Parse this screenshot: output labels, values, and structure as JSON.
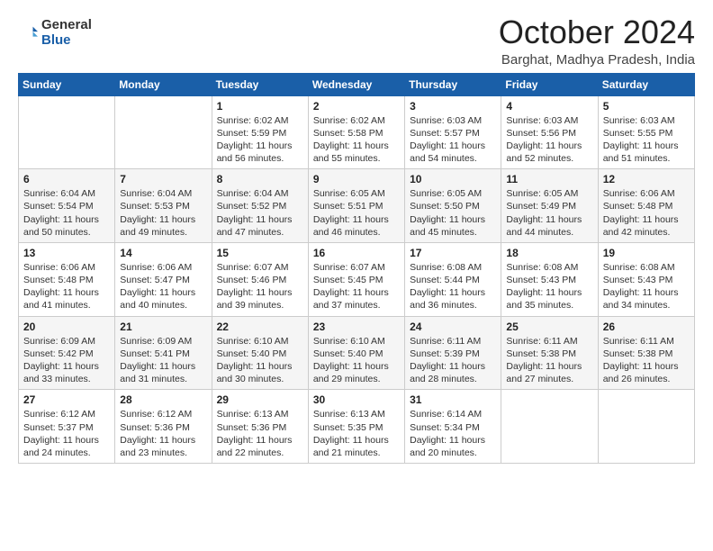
{
  "logo": {
    "general": "General",
    "blue": "Blue"
  },
  "header": {
    "month": "October 2024",
    "location": "Barghat, Madhya Pradesh, India"
  },
  "weekdays": [
    "Sunday",
    "Monday",
    "Tuesday",
    "Wednesday",
    "Thursday",
    "Friday",
    "Saturday"
  ],
  "weeks": [
    [
      {
        "day": "",
        "sunrise": "",
        "sunset": "",
        "daylight": ""
      },
      {
        "day": "",
        "sunrise": "",
        "sunset": "",
        "daylight": ""
      },
      {
        "day": "1",
        "sunrise": "Sunrise: 6:02 AM",
        "sunset": "Sunset: 5:59 PM",
        "daylight": "Daylight: 11 hours and 56 minutes."
      },
      {
        "day": "2",
        "sunrise": "Sunrise: 6:02 AM",
        "sunset": "Sunset: 5:58 PM",
        "daylight": "Daylight: 11 hours and 55 minutes."
      },
      {
        "day": "3",
        "sunrise": "Sunrise: 6:03 AM",
        "sunset": "Sunset: 5:57 PM",
        "daylight": "Daylight: 11 hours and 54 minutes."
      },
      {
        "day": "4",
        "sunrise": "Sunrise: 6:03 AM",
        "sunset": "Sunset: 5:56 PM",
        "daylight": "Daylight: 11 hours and 52 minutes."
      },
      {
        "day": "5",
        "sunrise": "Sunrise: 6:03 AM",
        "sunset": "Sunset: 5:55 PM",
        "daylight": "Daylight: 11 hours and 51 minutes."
      }
    ],
    [
      {
        "day": "6",
        "sunrise": "Sunrise: 6:04 AM",
        "sunset": "Sunset: 5:54 PM",
        "daylight": "Daylight: 11 hours and 50 minutes."
      },
      {
        "day": "7",
        "sunrise": "Sunrise: 6:04 AM",
        "sunset": "Sunset: 5:53 PM",
        "daylight": "Daylight: 11 hours and 49 minutes."
      },
      {
        "day": "8",
        "sunrise": "Sunrise: 6:04 AM",
        "sunset": "Sunset: 5:52 PM",
        "daylight": "Daylight: 11 hours and 47 minutes."
      },
      {
        "day": "9",
        "sunrise": "Sunrise: 6:05 AM",
        "sunset": "Sunset: 5:51 PM",
        "daylight": "Daylight: 11 hours and 46 minutes."
      },
      {
        "day": "10",
        "sunrise": "Sunrise: 6:05 AM",
        "sunset": "Sunset: 5:50 PM",
        "daylight": "Daylight: 11 hours and 45 minutes."
      },
      {
        "day": "11",
        "sunrise": "Sunrise: 6:05 AM",
        "sunset": "Sunset: 5:49 PM",
        "daylight": "Daylight: 11 hours and 44 minutes."
      },
      {
        "day": "12",
        "sunrise": "Sunrise: 6:06 AM",
        "sunset": "Sunset: 5:48 PM",
        "daylight": "Daylight: 11 hours and 42 minutes."
      }
    ],
    [
      {
        "day": "13",
        "sunrise": "Sunrise: 6:06 AM",
        "sunset": "Sunset: 5:48 PM",
        "daylight": "Daylight: 11 hours and 41 minutes."
      },
      {
        "day": "14",
        "sunrise": "Sunrise: 6:06 AM",
        "sunset": "Sunset: 5:47 PM",
        "daylight": "Daylight: 11 hours and 40 minutes."
      },
      {
        "day": "15",
        "sunrise": "Sunrise: 6:07 AM",
        "sunset": "Sunset: 5:46 PM",
        "daylight": "Daylight: 11 hours and 39 minutes."
      },
      {
        "day": "16",
        "sunrise": "Sunrise: 6:07 AM",
        "sunset": "Sunset: 5:45 PM",
        "daylight": "Daylight: 11 hours and 37 minutes."
      },
      {
        "day": "17",
        "sunrise": "Sunrise: 6:08 AM",
        "sunset": "Sunset: 5:44 PM",
        "daylight": "Daylight: 11 hours and 36 minutes."
      },
      {
        "day": "18",
        "sunrise": "Sunrise: 6:08 AM",
        "sunset": "Sunset: 5:43 PM",
        "daylight": "Daylight: 11 hours and 35 minutes."
      },
      {
        "day": "19",
        "sunrise": "Sunrise: 6:08 AM",
        "sunset": "Sunset: 5:43 PM",
        "daylight": "Daylight: 11 hours and 34 minutes."
      }
    ],
    [
      {
        "day": "20",
        "sunrise": "Sunrise: 6:09 AM",
        "sunset": "Sunset: 5:42 PM",
        "daylight": "Daylight: 11 hours and 33 minutes."
      },
      {
        "day": "21",
        "sunrise": "Sunrise: 6:09 AM",
        "sunset": "Sunset: 5:41 PM",
        "daylight": "Daylight: 11 hours and 31 minutes."
      },
      {
        "day": "22",
        "sunrise": "Sunrise: 6:10 AM",
        "sunset": "Sunset: 5:40 PM",
        "daylight": "Daylight: 11 hours and 30 minutes."
      },
      {
        "day": "23",
        "sunrise": "Sunrise: 6:10 AM",
        "sunset": "Sunset: 5:40 PM",
        "daylight": "Daylight: 11 hours and 29 minutes."
      },
      {
        "day": "24",
        "sunrise": "Sunrise: 6:11 AM",
        "sunset": "Sunset: 5:39 PM",
        "daylight": "Daylight: 11 hours and 28 minutes."
      },
      {
        "day": "25",
        "sunrise": "Sunrise: 6:11 AM",
        "sunset": "Sunset: 5:38 PM",
        "daylight": "Daylight: 11 hours and 27 minutes."
      },
      {
        "day": "26",
        "sunrise": "Sunrise: 6:11 AM",
        "sunset": "Sunset: 5:38 PM",
        "daylight": "Daylight: 11 hours and 26 minutes."
      }
    ],
    [
      {
        "day": "27",
        "sunrise": "Sunrise: 6:12 AM",
        "sunset": "Sunset: 5:37 PM",
        "daylight": "Daylight: 11 hours and 24 minutes."
      },
      {
        "day": "28",
        "sunrise": "Sunrise: 6:12 AM",
        "sunset": "Sunset: 5:36 PM",
        "daylight": "Daylight: 11 hours and 23 minutes."
      },
      {
        "day": "29",
        "sunrise": "Sunrise: 6:13 AM",
        "sunset": "Sunset: 5:36 PM",
        "daylight": "Daylight: 11 hours and 22 minutes."
      },
      {
        "day": "30",
        "sunrise": "Sunrise: 6:13 AM",
        "sunset": "Sunset: 5:35 PM",
        "daylight": "Daylight: 11 hours and 21 minutes."
      },
      {
        "day": "31",
        "sunrise": "Sunrise: 6:14 AM",
        "sunset": "Sunset: 5:34 PM",
        "daylight": "Daylight: 11 hours and 20 minutes."
      },
      {
        "day": "",
        "sunrise": "",
        "sunset": "",
        "daylight": ""
      },
      {
        "day": "",
        "sunrise": "",
        "sunset": "",
        "daylight": ""
      }
    ]
  ]
}
